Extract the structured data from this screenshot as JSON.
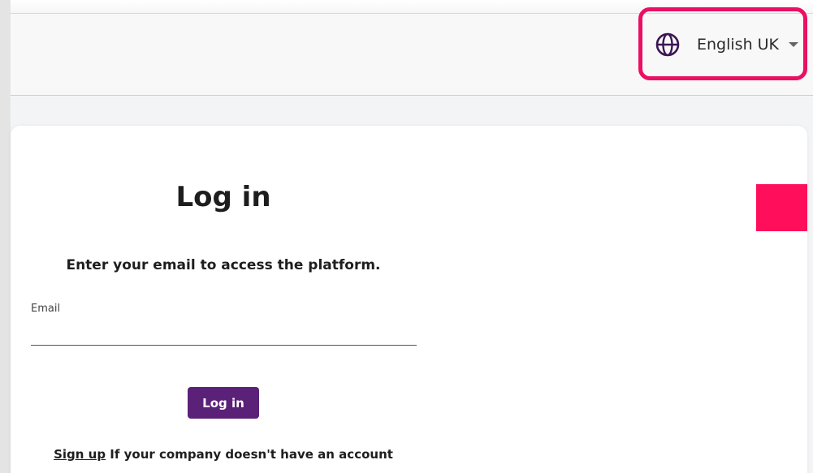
{
  "header": {
    "language": {
      "label": "English UK",
      "icon": "globe-icon",
      "highlight_color": "#ea1063"
    }
  },
  "login": {
    "title": "Log in",
    "subtitle": "Enter your email to access the platform.",
    "email_label": "Email",
    "email_value": "",
    "email_placeholder": "",
    "button_label": "Log in",
    "signup_link": "Sign up",
    "signup_text": "If your company doesn't have an account"
  },
  "colors": {
    "accent": "#5b2178",
    "brand_pink": "#ff0f5b"
  }
}
